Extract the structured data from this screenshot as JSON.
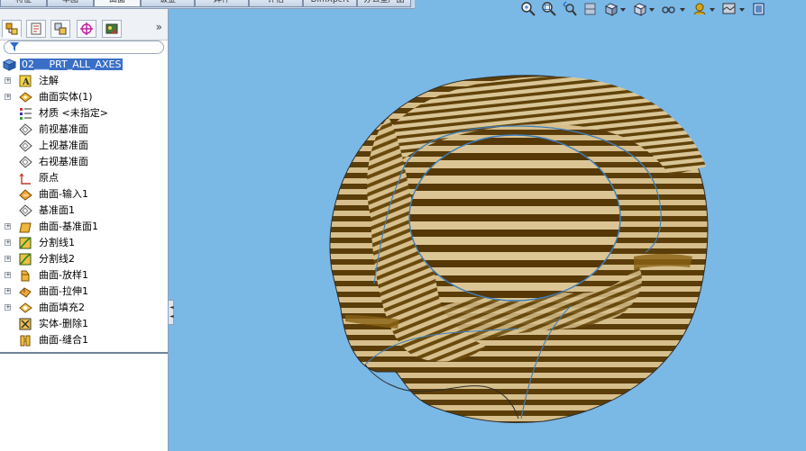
{
  "command_tabs": [
    "特征",
    "草图",
    "曲面",
    "钣金",
    "焊件",
    "评估",
    "DimXpert",
    "办公室产品"
  ],
  "active_tab": "曲面",
  "panel_tabs": [
    "feature-manager",
    "property-manager",
    "configuration-manager",
    "dimxpert-manager",
    "display-manager"
  ],
  "more_label": "»",
  "tree": {
    "root": "02___PRT_ALL_AXES",
    "items": [
      {
        "label": "注解",
        "expandable": true,
        "icon": "annotation-icon"
      },
      {
        "label": "曲面实体(1)",
        "expandable": true,
        "icon": "surface-bodies-icon"
      },
      {
        "label": "材质 <未指定>",
        "expandable": false,
        "icon": "material-icon"
      },
      {
        "label": "前视基准面",
        "expandable": false,
        "icon": "plane-icon"
      },
      {
        "label": "上视基准面",
        "expandable": false,
        "icon": "plane-icon"
      },
      {
        "label": "右视基准面",
        "expandable": false,
        "icon": "plane-icon"
      },
      {
        "label": "原点",
        "expandable": false,
        "icon": "origin-icon"
      },
      {
        "label": "曲面-输入1",
        "expandable": false,
        "icon": "imported-surface-icon"
      },
      {
        "label": "基准面1",
        "expandable": false,
        "icon": "plane-icon"
      },
      {
        "label": "曲面-基准面1",
        "expandable": true,
        "icon": "planar-surface-icon"
      },
      {
        "label": "分割线1",
        "expandable": true,
        "icon": "split-line-icon"
      },
      {
        "label": "分割线2",
        "expandable": true,
        "icon": "split-line-icon"
      },
      {
        "label": "曲面-放样1",
        "expandable": true,
        "icon": "loft-surface-icon"
      },
      {
        "label": "曲面-拉伸1",
        "expandable": true,
        "icon": "extrude-surface-icon"
      },
      {
        "label": "曲面填充2",
        "expandable": true,
        "icon": "fill-surface-icon"
      },
      {
        "label": "实体-删除1",
        "expandable": false,
        "icon": "delete-body-icon"
      },
      {
        "label": "曲面-缝合1",
        "expandable": false,
        "icon": "knit-surface-icon"
      }
    ]
  },
  "heads_up_toolbar": [
    "zoom-to-fit-icon",
    "zoom-to-area-icon",
    "previous-view-icon",
    "section-view-icon",
    "view-orientation-icon",
    "display-style-icon",
    "hide-show-items-icon",
    "edit-appearance-icon",
    "apply-scene-icon",
    "view-settings-icon"
  ],
  "colors": {
    "viewport_bg": "#7ab8e6",
    "zebra_dark": "#5a3d08",
    "zebra_light": "#d6bf8c",
    "tree_highlight": "#3a6fc7"
  }
}
